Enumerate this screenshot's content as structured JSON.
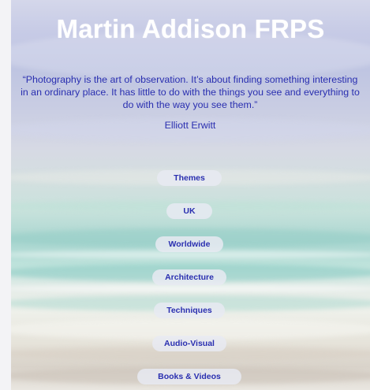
{
  "site": {
    "title": "Martin Addison FRPS"
  },
  "quote": {
    "text": "“Photography is the art of observation. It’s about finding something interesting in an ordinary place. It has little to do with the things you see and everything to do with the way you see them.”",
    "author": "Elliott Erwitt"
  },
  "nav": {
    "items": [
      {
        "label": "Themes"
      },
      {
        "label": "UK"
      },
      {
        "label": "Worldwide"
      },
      {
        "label": "Architecture"
      },
      {
        "label": "Techniques"
      },
      {
        "label": "Audio-Visual"
      },
      {
        "label": "Books & Videos"
      }
    ]
  },
  "colors": {
    "text_accent": "#2a2fb0",
    "title": "#ffffff",
    "button_bg": "#e8eaf2"
  }
}
